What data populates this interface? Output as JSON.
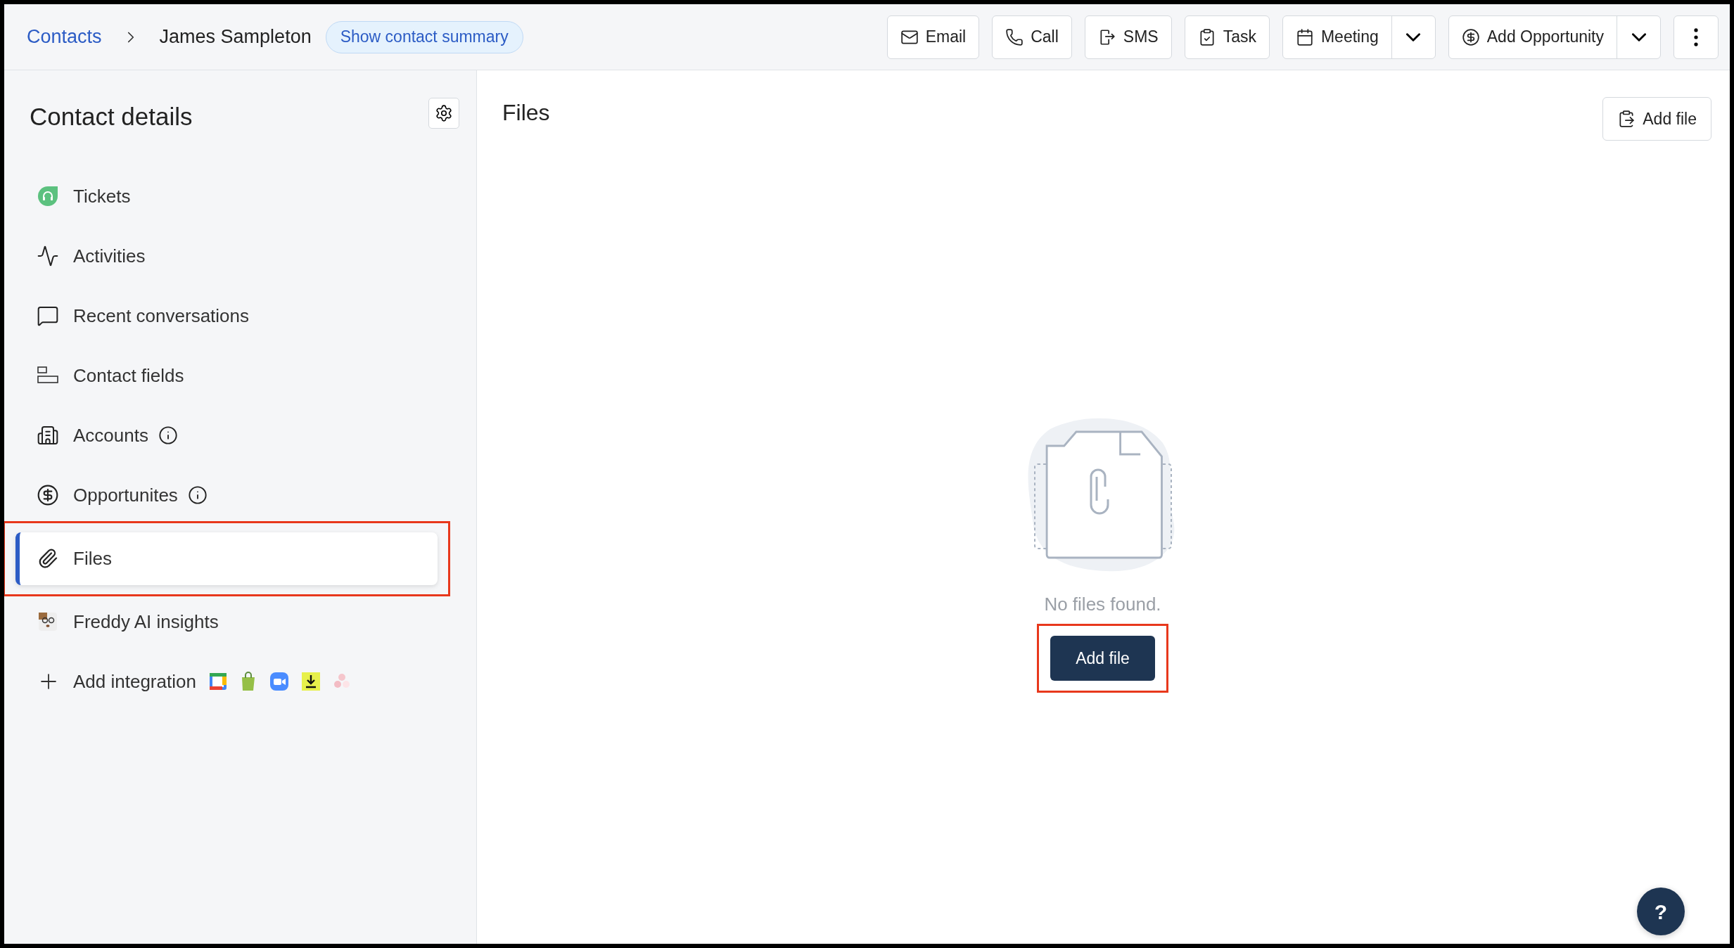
{
  "breadcrumb": {
    "parent": "Contacts",
    "current": "James Sampleton",
    "summary_button": "Show contact summary"
  },
  "actions": [
    {
      "label": "Email",
      "kind": "button"
    },
    {
      "label": "Call",
      "kind": "button"
    },
    {
      "label": "SMS",
      "kind": "button"
    },
    {
      "label": "Task",
      "kind": "button"
    },
    {
      "label": "Meeting",
      "kind": "split"
    },
    {
      "label": "Add Opportunity",
      "kind": "split"
    }
  ],
  "sidebar": {
    "title": "Contact details",
    "items": [
      {
        "label": "Tickets",
        "info": false,
        "selected": false,
        "highlighted": false
      },
      {
        "label": "Activities",
        "info": false,
        "selected": false,
        "highlighted": false
      },
      {
        "label": "Recent conversations",
        "info": false,
        "selected": false,
        "highlighted": false
      },
      {
        "label": "Contact fields",
        "info": false,
        "selected": false,
        "highlighted": false
      },
      {
        "label": "Accounts",
        "info": true,
        "selected": false,
        "highlighted": false
      },
      {
        "label": "Opportunites",
        "info": true,
        "selected": false,
        "highlighted": false
      },
      {
        "label": "Files",
        "info": false,
        "selected": true,
        "highlighted": true
      },
      {
        "label": "Freddy AI insights",
        "info": false,
        "selected": false,
        "highlighted": false
      }
    ],
    "add_integration": "Add integration"
  },
  "main": {
    "title": "Files",
    "add_button": "Add file",
    "empty_message": "No files found.",
    "empty_button": "Add file",
    "empty_button_highlighted": true
  },
  "help_button": "?"
}
